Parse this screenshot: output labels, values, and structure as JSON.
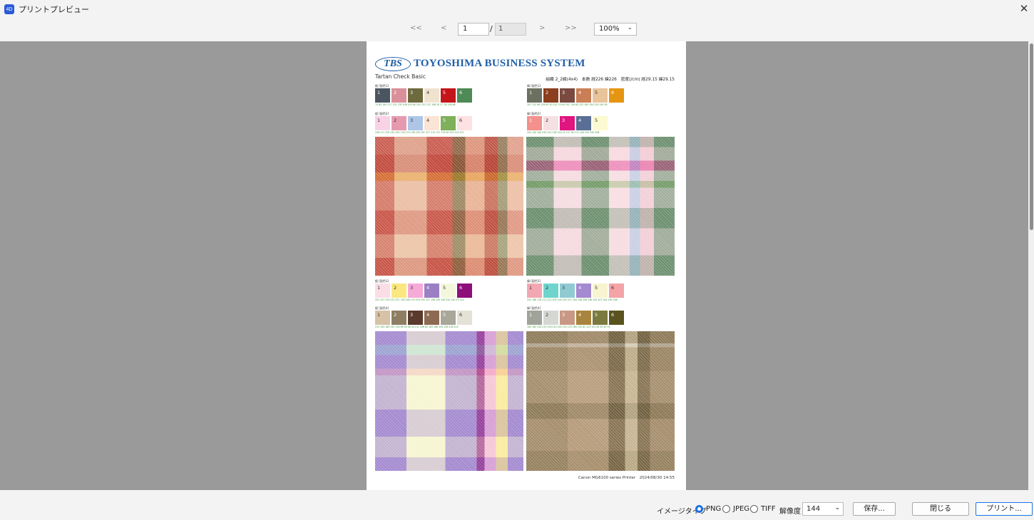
{
  "window": {
    "title": "プリントプレビュー",
    "app_icon": "4D",
    "close_glyph": "✕"
  },
  "nav": {
    "first": "<<",
    "prev": "<",
    "next": ">",
    "last": ">>",
    "page_current": "1",
    "page_sep": "/",
    "page_total": "1",
    "zoom": "100%"
  },
  "page": {
    "company": "TOYOSHIMA BUSINESS SYSTEM",
    "logo_text": "TBS",
    "title": "Tartan Check Basic",
    "info": "組織 2_2綾(4x4)　本数 経226 緯226　密度(/cm) 経29.15 緯29.15",
    "footer": "Canon MG6100 series Printer　2024/08/30 14:55"
  },
  "color_groups": [
    {
      "label": "経 [配色1]",
      "swatches": [
        {
          "n": "1",
          "color": "#4a5560"
        },
        {
          "n": "2",
          "color": "#d9909a"
        },
        {
          "n": "3",
          "color": "#6e6a3e"
        },
        {
          "n": "4",
          "color": "#efe3cf"
        },
        {
          "n": "5",
          "color": "#c4151b"
        },
        {
          "n": "6",
          "color": "#4e8a55"
        }
      ],
      "codes": "74 85 100   217 132 135   108 103 60   241 231 212   196 20 27   78 138 86"
    },
    {
      "label": "緯 [配色1]",
      "swatches": [
        {
          "n": "1",
          "color": "#6b7060"
        },
        {
          "n": "2",
          "color": "#8b3f1e"
        },
        {
          "n": "3",
          "color": "#7a4a40"
        },
        {
          "n": "4",
          "color": "#c97e55"
        },
        {
          "n": "5",
          "color": "#e9c39a"
        },
        {
          "n": "6",
          "color": "#e59512"
        }
      ],
      "codes": "107 112 96   139 63 30   122 74 64   201 126 85   233 195 154   229 149 18"
    },
    {
      "label": "経 [配色2]",
      "swatches": [
        {
          "n": "1",
          "color": "#f8d3e5"
        },
        {
          "n": "2",
          "color": "#e69ab0"
        },
        {
          "n": "3",
          "color": "#aec6e6"
        },
        {
          "n": "4",
          "color": "#fbe3d5"
        },
        {
          "n": "5",
          "color": "#7fb05a"
        },
        {
          "n": "6",
          "color": "#fde1e3"
        }
      ],
      "codes": "248 211 229   230 154 176   174 198 230   251 227 213   127 176 90   253 225 227"
    },
    {
      "label": "緯 [配色2]",
      "swatches": [
        {
          "n": "1",
          "color": "#f4918c"
        },
        {
          "n": "2",
          "color": "#f5e0e4"
        },
        {
          "n": "3",
          "color": "#e0157f"
        },
        {
          "n": "4",
          "color": "#5a6f95"
        },
        {
          "n": "5",
          "color": "#fcfad0"
        }
      ],
      "codes": "244 145 140   245 224 228   224 21 127   90 111 149   252 250 208"
    },
    {
      "label": "経 [配色3]",
      "swatches": [
        {
          "n": "1",
          "color": "#fbdde5"
        },
        {
          "n": "2",
          "color": "#fbe780"
        },
        {
          "n": "3",
          "color": "#f6aad8"
        },
        {
          "n": "4",
          "color": "#9b7fc4"
        },
        {
          "n": "5",
          "color": "#f3f8dc"
        },
        {
          "n": "6",
          "color": "#8c0f7a"
        }
      ],
      "codes": "251 221 229   251 231 128   246 170 216   155 127 196   243 248 220   140 15 122"
    },
    {
      "label": "緯 [配色3]",
      "swatches": [
        {
          "n": "1",
          "color": "#f2a8b2"
        },
        {
          "n": "2",
          "color": "#6fd4cd"
        },
        {
          "n": "3",
          "color": "#90cbd3"
        },
        {
          "n": "4",
          "color": "#a48ad0"
        },
        {
          "n": "5",
          "color": "#f8f4cf"
        },
        {
          "n": "6",
          "color": "#f4a3a6"
        }
      ],
      "codes": "242 168 178   111 212 205   144 203 211   164 138 208   248 244 207   244 163 166"
    },
    {
      "label": "経 [配色4]",
      "swatches": [
        {
          "n": "1",
          "color": "#d7c2a5"
        },
        {
          "n": "2",
          "color": "#8e7e62"
        },
        {
          "n": "3",
          "color": "#5a3a2c"
        },
        {
          "n": "4",
          "color": "#8d6a52"
        },
        {
          "n": "5",
          "color": "#a9a69a"
        },
        {
          "n": "6",
          "color": "#e4e2d6"
        }
      ],
      "codes": "215 194 165   142 126 98   90 58 44   141 106 82   169 166 154   228 226 214"
    },
    {
      "label": "緯 [配色4]",
      "swatches": [
        {
          "n": "1",
          "color": "#a0a39a"
        },
        {
          "n": "2",
          "color": "#d5d8d2"
        },
        {
          "n": "3",
          "color": "#c89884"
        },
        {
          "n": "4",
          "color": "#a9843e"
        },
        {
          "n": "5",
          "color": "#7a7a3e"
        },
        {
          "n": "6",
          "color": "#5a5320"
        }
      ],
      "codes": "160 163 154   213 216 210   200 152 132   169 132 62   122 122 62   90 83 32"
    }
  ],
  "tartans": [
    {
      "name": "tartan-1",
      "base": "#efc4aa",
      "warp": [
        [
          "#c9574a",
          6
        ],
        [
          "#ecc3a6",
          10
        ],
        [
          "#c9574a",
          8
        ],
        [
          "#6e6a3e",
          4
        ],
        [
          "#e9b08f",
          6
        ],
        [
          "#b84b3a",
          4
        ],
        [
          "#7b8d60",
          3
        ],
        [
          "#efc4aa",
          5
        ]
      ],
      "weft": [
        [
          "#c96a5e",
          6
        ],
        [
          "#b6352a",
          6
        ],
        [
          "#e59512",
          3
        ],
        [
          "#e9b8a0",
          10
        ],
        [
          "#c9574a",
          8
        ],
        [
          "#ecc7a8",
          8
        ],
        [
          "#c4503f",
          6
        ]
      ]
    },
    {
      "name": "tartan-2",
      "base": "#f6dbe0",
      "warp": [
        [
          "#6d9070",
          8
        ],
        [
          "#f5d9df",
          8
        ],
        [
          "#6d9070",
          8
        ],
        [
          "#f7dde2",
          6
        ],
        [
          "#aec6e6",
          3
        ],
        [
          "#f1c7d2",
          4
        ],
        [
          "#6d9070",
          6
        ]
      ],
      "weft": [
        [
          "#6d9070",
          3
        ],
        [
          "#f6d4dc",
          4
        ],
        [
          "#e0157f",
          3
        ],
        [
          "#f5e0e4",
          3
        ],
        [
          "#7fb05a",
          2
        ],
        [
          "#f7e0e4",
          6
        ],
        [
          "#6d9070",
          6
        ],
        [
          "#f6dbe0",
          8
        ],
        [
          "#6d9070",
          6
        ]
      ]
    },
    {
      "name": "tartan-3",
      "base": "#f6f5d2",
      "warp": [
        [
          "#a48ad0",
          8
        ],
        [
          "#f6f5d2",
          10
        ],
        [
          "#a48ad0",
          8
        ],
        [
          "#8c0f7a",
          2
        ],
        [
          "#f6aad8",
          3
        ],
        [
          "#fbe780",
          3
        ],
        [
          "#a48ad0",
          4
        ]
      ],
      "weft": [
        [
          "#a48ad0",
          4
        ],
        [
          "#90cbd3",
          3
        ],
        [
          "#a48ad0",
          4
        ],
        [
          "#f2a8b2",
          2
        ],
        [
          "#f6f5d2",
          10
        ],
        [
          "#a48ad0",
          8
        ],
        [
          "#f6f5d2",
          6
        ],
        [
          "#a48ad0",
          4
        ]
      ]
    },
    {
      "name": "tartan-4",
      "base": "#b69b7a",
      "warp": [
        [
          "#9a8462",
          10
        ],
        [
          "#b69b7a",
          10
        ],
        [
          "#6b5a3a",
          4
        ],
        [
          "#d2c4a0",
          3
        ],
        [
          "#6b5a3a",
          3
        ],
        [
          "#9a8462",
          6
        ]
      ],
      "weft": [
        [
          "#7a6a48",
          3
        ],
        [
          "#d5d8d2",
          1
        ],
        [
          "#9a8462",
          6
        ],
        [
          "#b8a07e",
          8
        ],
        [
          "#7a6a48",
          4
        ],
        [
          "#b69b7a",
          8
        ],
        [
          "#8d7a56",
          5
        ]
      ]
    }
  ],
  "bottom": {
    "image_type_label": "イメージタイプ",
    "png": "PNG",
    "jpeg": "JPEG",
    "tiff": "TIFF",
    "resolution_label": "解像度",
    "resolution": "144",
    "save": "保存...",
    "close": "閉じる",
    "print": "プリント..."
  },
  "colors": {
    "accent": "#1a73e8",
    "brand": "#1f5fa8",
    "viewport_bg": "#9a9a9a"
  }
}
